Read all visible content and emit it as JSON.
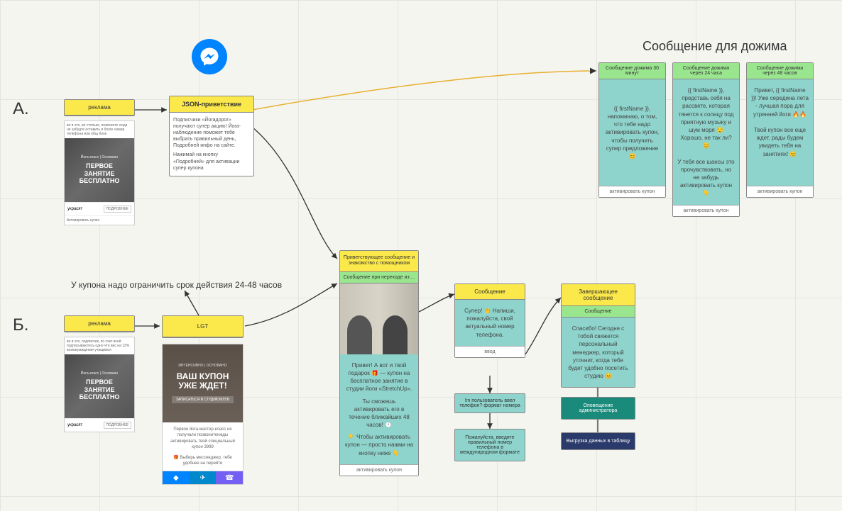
{
  "sections": {
    "a": "А.",
    "b": "Б."
  },
  "titles": {
    "followup": "Сообщение для дожима",
    "coupon_note": "У купона надо ограничить срок действия 24-48 часов"
  },
  "rowA": {
    "ad_label": "реклама",
    "ad_desc": "во в это, во столько, позвоните сюда не забудте оставить в блоге номер телефона или общ блок",
    "ad_sub": "Йога-класс | Основано",
    "ad_text1": "ПЕРВОЕ",
    "ad_text2": "ЗАНЯТИЕ",
    "ad_text3": "БЕСПЛАТНО",
    "ad_card_foot_left": "украсят",
    "ad_card_foot_btn": "ПОДРОБНЕЕ",
    "ad_card_bottom": "Активировать купон",
    "json_title": "JSON-приветствие",
    "json_body1": "Подписчики «Йогадорог» получают супер акцию! Йога-наблюдение поможет тебе выбрать правильный день, Подробней инфо на сайте.",
    "json_body2": "Нажимай на кнопку «Подробней» для активации супер купона"
  },
  "rowB": {
    "ad_label": "реклама",
    "ad_desc": "во в это, подписчик, по счет всей подписываютесь одно что вас на 12% вознаграждение учащимся",
    "lgt_label": "LGT",
    "coupon_sub": "ИНТЕНСИВНО | ОСНОВАНО",
    "coupon_text1": "ВАШ КУПОН",
    "coupon_text2": "УЖЕ ЖДЕТ!",
    "coupon_btn": "ЗАПИСАТЬСЯ В СТУДИЮ/КЛУБ",
    "coupon_body": "Первое йога-мастер-класс не получали позвонитенжды активировать твой специальный купон 3999",
    "coupon_body2": "🎁 Выберь мессенджер, тебе удобнее на перейти"
  },
  "welcome": {
    "title": "Приветствующее сообщение и знакомство с помощником",
    "sub": "Сообщение при переходе из ...",
    "body1": "Привет! А вот и твой подарок 🎁 — купон на бесплатное занятие в студии йоги «StretchUp».",
    "body2": "Ты сможешь активировать его в течение ближайших 48 часов! 🕐",
    "body3": "👇 Чтобы активировать купон — просто нажми на кнопку ниже 👇",
    "footer": "активировать купон"
  },
  "msg": {
    "title": "Сообщение",
    "body": "Супер! 👏 Напиши, пожалуйста, свой актуальный номер телефона.",
    "input": "ввод",
    "validate": "!m пользователь ввел телефон? формат номера",
    "error": "Пожалуйста, введите правильный номер телефона в международном формате"
  },
  "final": {
    "title": "Завершающее сообщение",
    "sub": "Сообщение",
    "body": "Спасибо! Сегодня с тобой свяжется персональный менеджер, который уточнит, когда тебе будет удобно посетить студию 😊",
    "notify": "Оповещение администратора",
    "export": "Выгрузка данных в таблицу"
  },
  "followups": {
    "f1": {
      "title": "Сообщение дожима 30 минут",
      "body": "{{ firstName }}, напоминаю, о том, что тебе надо активировать купон, чтобы получить супер предложение 😊",
      "footer": "активировать купон"
    },
    "f2": {
      "title": "Сообщение дожима через 24 часа",
      "body": "{{ firstName }}, представь себя на рассвете, которая тянется к солнцу под приятную музыку и шум моря 😌 Хорошо, не так ли? 😊\n\nУ тебя все шансы это прочувствовать, но не забудь активировать купон 👇",
      "footer": "активировать купон"
    },
    "f3": {
      "title": "Сообщение дожима через 48 часов",
      "body": "Привет, {{ firstName }}! Уже середина лета - лучшая пора для утренней йоги 🔥🔥\n\nТвой купон все еще ждет, рады будем увидеть тебя на занятиях! 😊",
      "footer": "активировать купон"
    }
  }
}
